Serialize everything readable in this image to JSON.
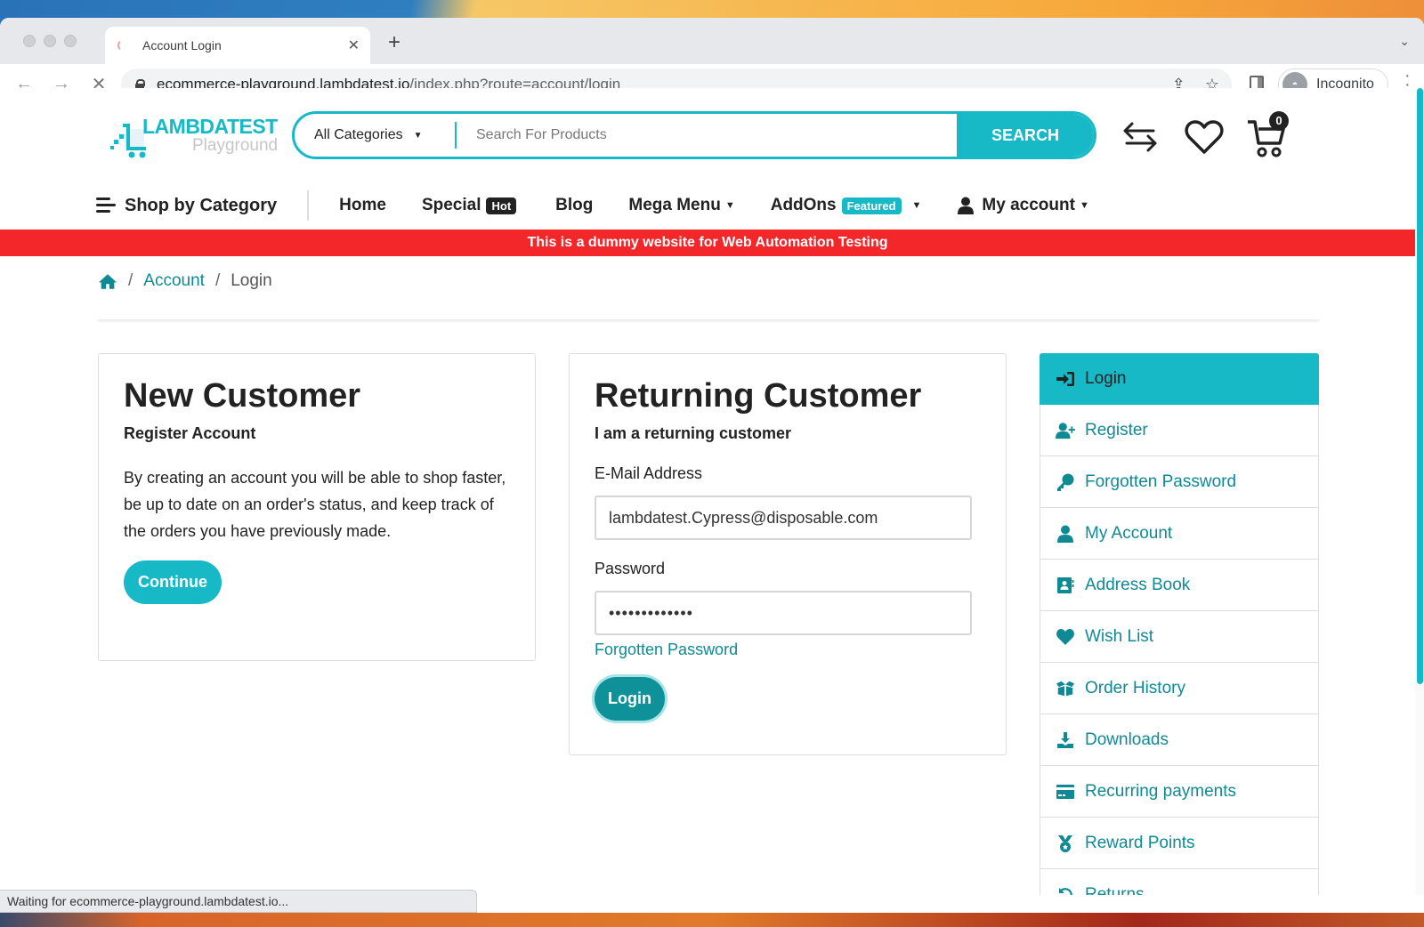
{
  "browser": {
    "tab_title": "Account Login",
    "url_host": "ecommerce-playground.lambdatest.io",
    "url_path": "/index.php?route=account/login",
    "profile_label": "Incognito",
    "status_text": "Waiting for ecommerce-playground.lambdatest.io..."
  },
  "header": {
    "logo_brand": "LAMBDATEST",
    "logo_sub": "Playground",
    "category_select": "All Categories",
    "search_placeholder": "Search For Products",
    "search_button": "SEARCH",
    "cart_count": "0",
    "icons": [
      "compare-icon",
      "wishlist-heart-icon",
      "cart-icon"
    ]
  },
  "nav": {
    "shop_by_category": "Shop by Category",
    "items": [
      {
        "label": "Home"
      },
      {
        "label": "Special",
        "badge": "Hot",
        "badge_color": "#222222"
      },
      {
        "label": "Blog"
      },
      {
        "label": "Mega Menu",
        "dropdown": true
      },
      {
        "label": "AddOns",
        "badge": "Featured",
        "badge_color": "#17b9c7",
        "dropdown": true
      },
      {
        "label": "My account",
        "dropdown": true
      }
    ]
  },
  "banner": {
    "text": "This is a dummy website for Web Automation Testing",
    "color": "#f3272a"
  },
  "breadcrumb": {
    "items": [
      "Account",
      "Login"
    ]
  },
  "new_customer": {
    "title": "New Customer",
    "subtitle": "Register Account",
    "body": "By creating an account you will be able to shop faster, be up to date on an order's status, and keep track of the orders you have previously made.",
    "button": "Continue"
  },
  "returning_customer": {
    "title": "Returning Customer",
    "subtitle": "I am a returning customer",
    "email_label": "E-Mail Address",
    "email_value": "lambdatest.Cypress@disposable.com",
    "password_label": "Password",
    "password_value": "•••••••••••••",
    "forgot_link": "Forgotten Password",
    "login_button": "Login"
  },
  "sidebar": {
    "items": [
      {
        "label": "Login",
        "icon": "sign-in-icon",
        "active": true
      },
      {
        "label": "Register",
        "icon": "user-plus-icon"
      },
      {
        "label": "Forgotten Password",
        "icon": "key-icon"
      },
      {
        "label": "My Account",
        "icon": "user-icon"
      },
      {
        "label": "Address Book",
        "icon": "address-book-icon"
      },
      {
        "label": "Wish List",
        "icon": "heart-icon"
      },
      {
        "label": "Order History",
        "icon": "box-open-icon"
      },
      {
        "label": "Downloads",
        "icon": "download-icon"
      },
      {
        "label": "Recurring payments",
        "icon": "credit-card-icon"
      },
      {
        "label": "Reward Points",
        "icon": "medal-icon"
      },
      {
        "label": "Returns",
        "icon": "undo-icon"
      }
    ]
  },
  "colors": {
    "accent": "#17b9c7",
    "link": "#0f8a94",
    "login_button": "#0e9199"
  }
}
